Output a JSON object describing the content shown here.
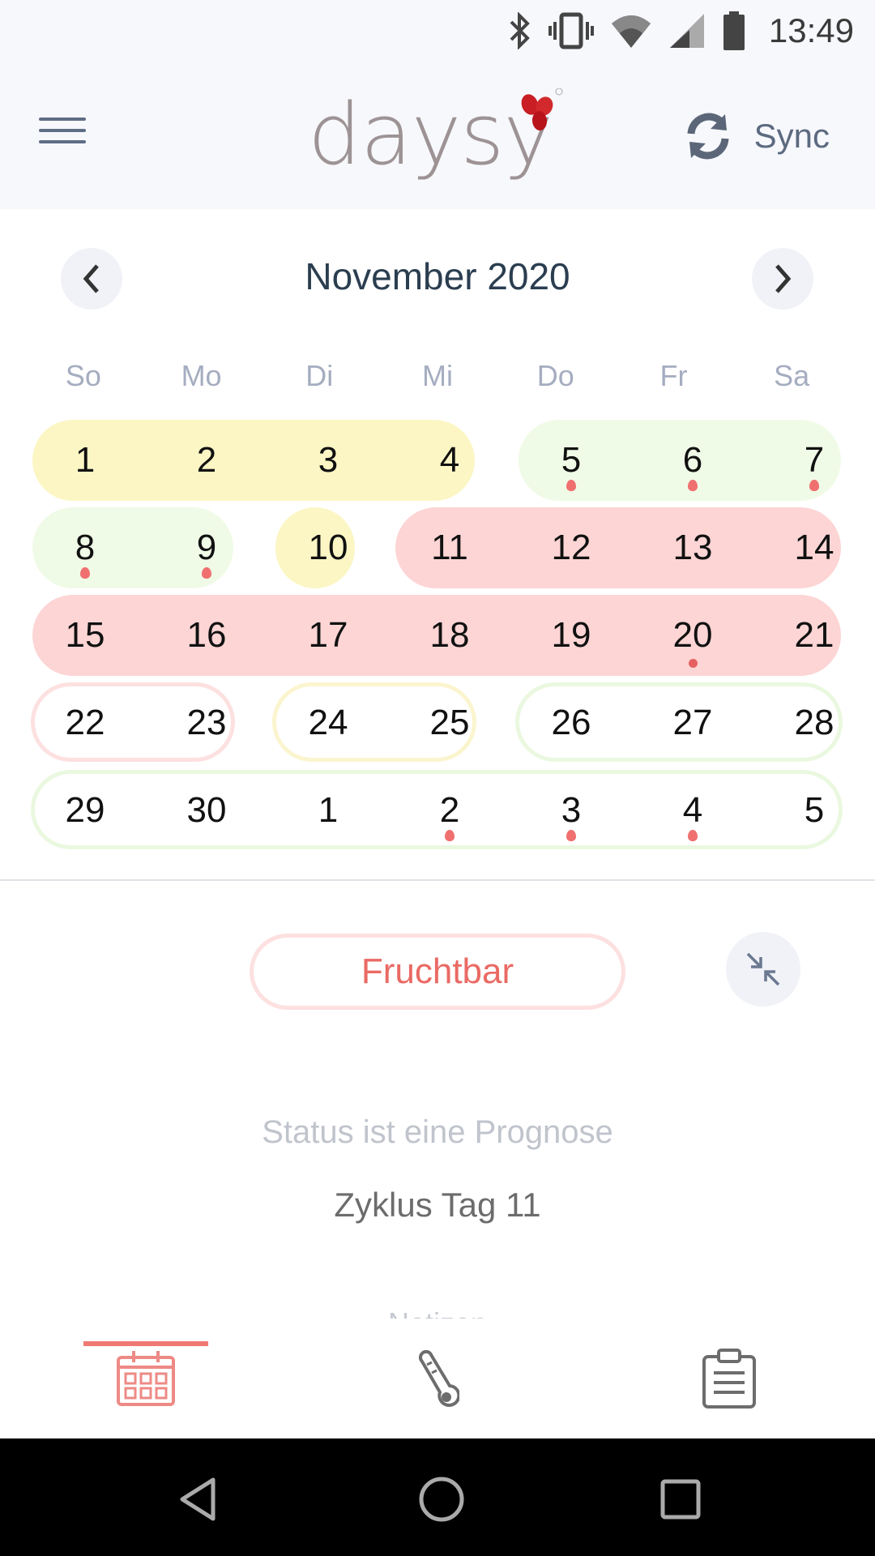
{
  "status_bar": {
    "time": "13:49",
    "icons": [
      "bluetooth-icon",
      "vibrate-icon",
      "wifi-icon",
      "signal-icon",
      "battery-icon"
    ]
  },
  "header": {
    "logo": "daysy",
    "sync_label": "Sync"
  },
  "calendar": {
    "month_title": "November 2020",
    "weekdays": [
      "So",
      "Mo",
      "Di",
      "Mi",
      "Do",
      "Fr",
      "Sa"
    ],
    "weeks": [
      [
        "1",
        "2",
        "3",
        "4",
        "5",
        "6",
        "7"
      ],
      [
        "8",
        "9",
        "10",
        "11",
        "12",
        "13",
        "14"
      ],
      [
        "15",
        "16",
        "17",
        "18",
        "19",
        "20",
        "21"
      ],
      [
        "22",
        "23",
        "24",
        "25",
        "26",
        "27",
        "28"
      ],
      [
        "29",
        "30",
        "1",
        "2",
        "3",
        "4",
        "5"
      ]
    ]
  },
  "status": {
    "fertility_label": "Fruchtbar",
    "prognosis_text": "Status ist eine Prognose",
    "cycle_day_text": "Zyklus Tag 11",
    "notes_label": "Notizen"
  },
  "tabs": [
    "calendar-tab",
    "temperature-tab",
    "notes-tab"
  ],
  "colors": {
    "accent": "#ee7a73",
    "fertile": "#fdd5d5",
    "unsure": "#fbf6c4",
    "infertile": "#f0fbe7",
    "menstruation_drop": "#f07070"
  }
}
